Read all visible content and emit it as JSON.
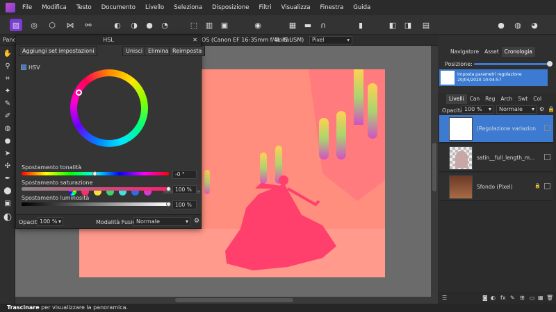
{
  "menu": {
    "items": [
      "File",
      "Modifica",
      "Testo",
      "Documento",
      "Livello",
      "Seleziona",
      "Disposizione",
      "Filtri",
      "Visualizza",
      "Finestra",
      "Guida"
    ]
  },
  "context": {
    "panel_cut": "Panc",
    "lens": "OS (Canon EF 16-35mm f/4L IS USM)",
    "unit_label": "Unità:",
    "unit_value": "Pixel"
  },
  "hsl": {
    "title": "HSL",
    "add_preset": "Aggiungi set impostazioni",
    "merge": "Unisci",
    "delete": "Elimina",
    "reset": "Reimposta",
    "hsv_label": "HSV",
    "hsv_checked": true,
    "picker": "Selezionatore",
    "swatches": [
      "#ff2a6d",
      "#f4e23a",
      "#3fd36b",
      "#3fe0e0",
      "#2b6df0",
      "#d63ad8"
    ],
    "hue_label": "Spostamento tonalità",
    "hue_value": "-0 °",
    "hue_fraction": 0.5,
    "sat_label": "Spostamento saturazione",
    "sat_value": "100 %",
    "sat_fraction": 1.0,
    "lum_label": "Spostamento luminosità",
    "lum_value": "100 %",
    "lum_fraction": 1.0,
    "opacity_label": "Opacità:",
    "opacity_value": "100 %",
    "blend_label": "Modalità Fusione:",
    "blend_value": "Normale"
  },
  "right_top": {
    "tabs": [
      "Navigatore",
      "Asset",
      "Cronologia"
    ],
    "active": "Cronologia",
    "position_label": "Posizione:",
    "history_title": "Imposta parametri regolazione",
    "history_time": "20/04/2020 10:04:57"
  },
  "layers": {
    "tabs": [
      "Livelli",
      "Can",
      "Reg",
      "Arch",
      "Swt",
      "Col"
    ],
    "active": "Livelli",
    "opacity_label": "Opacità:",
    "opacity_value": "100 %",
    "blend_value": "Normale",
    "items": [
      {
        "name": "(Regolazione variazion...",
        "selected": true
      },
      {
        "name": "satin__full_length_m...",
        "selected": false
      },
      {
        "name": "Sfondo (Pixel)",
        "selected": false
      }
    ]
  },
  "status": {
    "bold": "Trascinare",
    "text": " per visualizzare la panoramica."
  },
  "colors": {
    "accent": "#3c7bd1",
    "canvas_tint": "#ff8c7f",
    "dress": "#ff3f6c"
  }
}
